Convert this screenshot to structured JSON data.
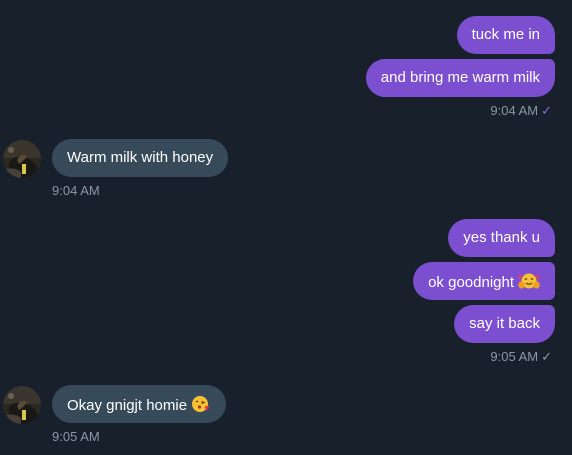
{
  "messages": {
    "m1": "tuck me in",
    "m2": "and bring me warm milk",
    "t1": "9:04 AM",
    "m3": "Warm milk with honey",
    "t2": "9:04 AM",
    "m4": "yes thank u",
    "m5": "ok goodnight",
    "m6": "say it back",
    "t3": "9:05 AM",
    "m7": "Okay gnigjt homie",
    "t4": "9:05 AM"
  },
  "icons": {
    "read_check": "checkmark-icon",
    "avatar": "contact-avatar",
    "hug_emoji": "hugging-face-emoji",
    "kiss_emoji": "face-blowing-kiss-emoji"
  },
  "colors": {
    "background": "#17202b",
    "outgoing_bubble": "#7b4fcf",
    "incoming_bubble": "#374a59",
    "timestamp": "#8b98a5"
  }
}
